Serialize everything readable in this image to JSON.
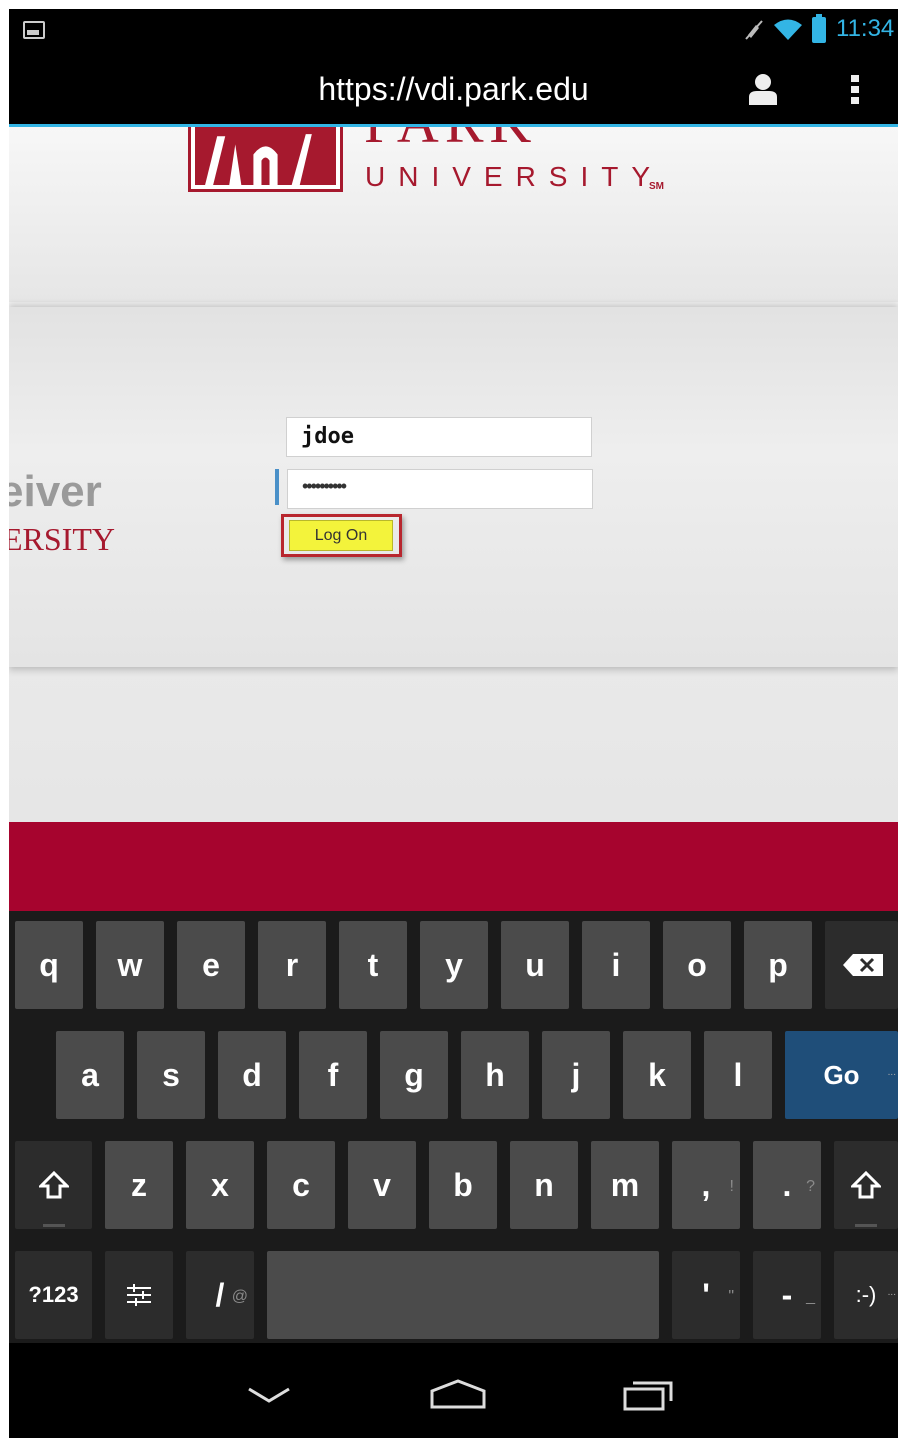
{
  "status_bar": {
    "time": "11:34",
    "icons": [
      "image-notification-icon",
      "mute-icon",
      "wifi-icon",
      "battery-icon"
    ],
    "accent_color": "#33b5e5"
  },
  "browser": {
    "url": "https://vdi.park.edu",
    "icons": [
      "account-icon",
      "overflow-menu-icon"
    ]
  },
  "page": {
    "logo_wordmark": "PARK",
    "logo_subtitle": "UNIVERSITY",
    "logo_sm": "SM",
    "brand_color": "#a6192e",
    "receiver_title": "eiver",
    "receiver_subtitle": "ERSITY",
    "username_value": "jdoe",
    "password_value": "••••••••••",
    "logon_label": "Log On",
    "logon_color": "#f3f33b"
  },
  "keyboard": {
    "row1": [
      "q",
      "w",
      "e",
      "r",
      "t",
      "y",
      "u",
      "i",
      "o",
      "p"
    ],
    "row2": [
      "a",
      "s",
      "d",
      "f",
      "g",
      "h",
      "j",
      "k",
      "l"
    ],
    "row3": [
      "z",
      "x",
      "c",
      "v",
      "b",
      "n",
      "m",
      ",",
      "."
    ],
    "row3_hints": [
      "!",
      "?"
    ],
    "go_label": "Go",
    "symbols_label": "?123",
    "slash_label": "/",
    "slash_hint": "@",
    "apostrophe_label": "'",
    "apostrophe_hint": "\"",
    "dash_label": "-",
    "dash_hint": "_",
    "smiley_label": ":-)",
    "more_dots": "..."
  }
}
